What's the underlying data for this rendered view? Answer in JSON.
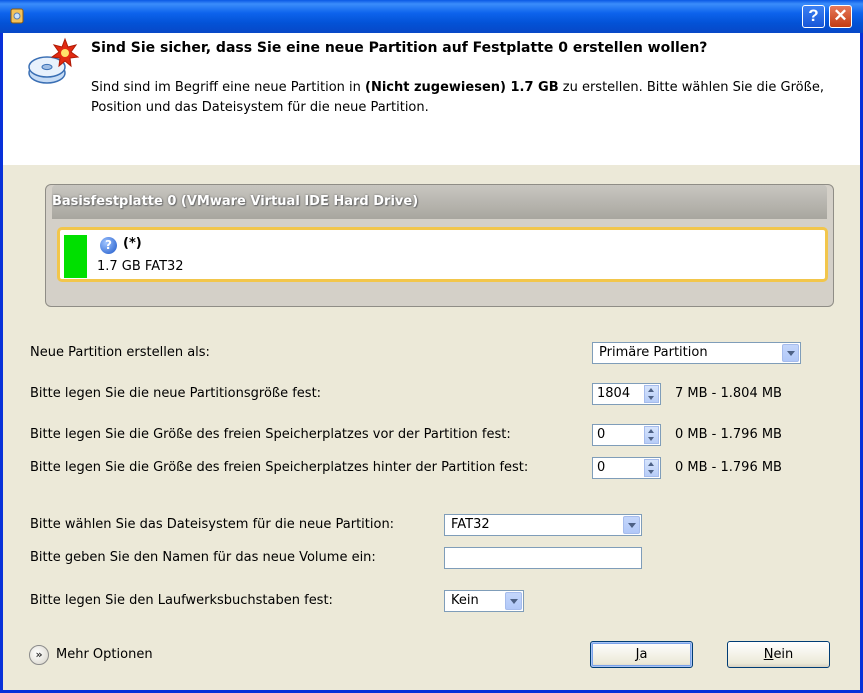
{
  "titlebar": {
    "help_label": "?",
    "close_label": "✕"
  },
  "header": {
    "title": "Sind Sie sicher, dass Sie eine neue Partition auf Festplatte 0 erstellen wollen?",
    "desc_pre": "Sind sind im Begriff eine neue Partition in ",
    "desc_bold": "(Nicht zugewiesen) 1.7 GB",
    "desc_post": " zu erstellen. Bitte wählen Sie die Größe, Position und das Dateisystem für die neue Partition."
  },
  "disk": {
    "title": "Basisfestplatte 0 (VMware Virtual IDE Hard Drive)",
    "partition_label": "(*)",
    "partition_info": "1.7 GB FAT32",
    "partition_color": "#00e000"
  },
  "form": {
    "type_label": "Neue Partition erstellen als:",
    "type_value": "Primäre Partition",
    "size_label": "Bitte legen Sie die neue Partitionsgröße fest:",
    "size_value": "1804",
    "size_range": "7 MB - 1.804 MB",
    "before_label": "Bitte legen Sie die Größe des freien Speicherplatzes vor der Partition fest:",
    "before_value": "0",
    "before_range": "0 MB - 1.796 MB",
    "after_label": "Bitte legen Sie die Größe des freien Speicherplatzes hinter der Partition fest:",
    "after_value": "0",
    "after_range": "0 MB - 1.796 MB",
    "fs_label": "Bitte wählen Sie das Dateisystem für die neue Partition:",
    "fs_value": "FAT32",
    "volume_label": "Bitte geben Sie den Namen für das neue Volume ein:",
    "volume_value": "",
    "drive_label": "Bitte legen Sie den Laufwerksbuchstaben fest:",
    "drive_value": "Kein"
  },
  "footer": {
    "more_options": "Mehr Optionen",
    "yes_accel": "J",
    "yes_rest": "a",
    "no_accel": "N",
    "no_rest": "ein"
  }
}
